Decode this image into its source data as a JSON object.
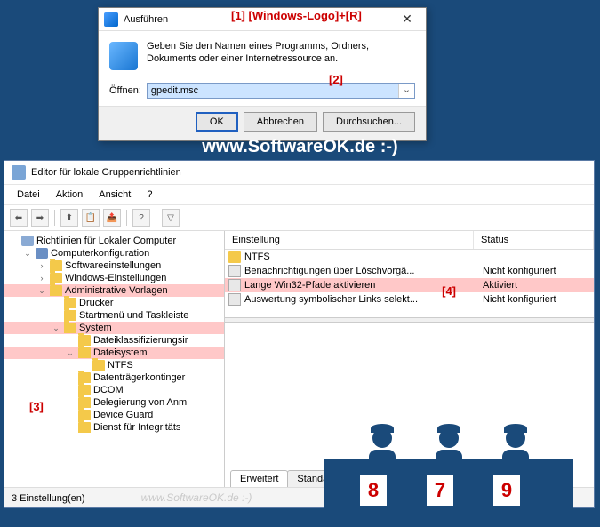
{
  "run": {
    "title": "Ausführen",
    "desc": "Geben Sie den Namen eines Programms, Ordners, Dokuments oder einer Internetressource an.",
    "open_label": "Öffnen:",
    "value": "gpedit.msc",
    "ok": "OK",
    "cancel": "Abbrechen",
    "browse": "Durchsuchen..."
  },
  "annotations": {
    "a1": "[1]  [Windows-Logo]+[R]",
    "a2": "[2]",
    "a3": "[3]",
    "a4": "[4]"
  },
  "url_text": "www.SoftwareOK.de :-)",
  "gp": {
    "title": "Editor für lokale Gruppenrichtlinien",
    "menu": [
      "Datei",
      "Aktion",
      "Ansicht",
      "?"
    ],
    "tree": [
      {
        "depth": 0,
        "exp": "",
        "icon": "root",
        "label": "Richtlinien für Lokaler Computer",
        "hl": false
      },
      {
        "depth": 1,
        "exp": "⌄",
        "icon": "comp",
        "label": "Computerkonfiguration",
        "hl": false
      },
      {
        "depth": 2,
        "exp": "›",
        "icon": "folder",
        "label": "Softwareeinstellungen",
        "hl": false
      },
      {
        "depth": 2,
        "exp": "›",
        "icon": "folder",
        "label": "Windows-Einstellungen",
        "hl": false
      },
      {
        "depth": 2,
        "exp": "⌄",
        "icon": "folder",
        "label": "Administrative Vorlagen",
        "hl": true
      },
      {
        "depth": 3,
        "exp": "",
        "icon": "folder",
        "label": "Drucker",
        "hl": false
      },
      {
        "depth": 3,
        "exp": "",
        "icon": "folder",
        "label": "Startmenü und Taskleiste",
        "hl": false
      },
      {
        "depth": 3,
        "exp": "⌄",
        "icon": "folder",
        "label": "System",
        "hl": true
      },
      {
        "depth": 4,
        "exp": "",
        "icon": "folder",
        "label": "Dateiklassifizierungsir",
        "hl": false
      },
      {
        "depth": 4,
        "exp": "⌄",
        "icon": "folder",
        "label": "Dateisystem",
        "hl": true
      },
      {
        "depth": 5,
        "exp": "",
        "icon": "folder",
        "label": "NTFS",
        "hl": false
      },
      {
        "depth": 4,
        "exp": "",
        "icon": "folder",
        "label": "Datenträgerkontinger",
        "hl": false
      },
      {
        "depth": 4,
        "exp": "",
        "icon": "folder",
        "label": "DCOM",
        "hl": false
      },
      {
        "depth": 4,
        "exp": "",
        "icon": "folder",
        "label": "Delegierung von Anm",
        "hl": false
      },
      {
        "depth": 4,
        "exp": "",
        "icon": "folder",
        "label": "Device Guard",
        "hl": false
      },
      {
        "depth": 4,
        "exp": "",
        "icon": "folder",
        "label": "Dienst für Integritäts",
        "hl": false
      }
    ],
    "columns": {
      "c1": "Einstellung",
      "c2": "Status"
    },
    "rows": [
      {
        "icon": "folder",
        "name": "NTFS",
        "status": "",
        "hl": false
      },
      {
        "icon": "setting",
        "name": "Benachrichtigungen über Löschvorgä...",
        "status": "Nicht konfiguriert",
        "hl": false
      },
      {
        "icon": "setting",
        "name": "Lange Win32-Pfade aktivieren",
        "status": "Aktiviert",
        "hl": true
      },
      {
        "icon": "setting",
        "name": "Auswertung symbolischer Links selekt...",
        "status": "Nicht konfiguriert",
        "hl": false
      }
    ],
    "tabs": {
      "extended": "Erweitert",
      "standard": "Standard"
    },
    "status": "3 Einstellung(en)"
  },
  "watermarks": {
    "w1": "www.SoftwareOK.de  :-)",
    "w2": "www.SoftwareOK.de  :-)"
  },
  "cards": [
    "8",
    "7",
    "9"
  ]
}
